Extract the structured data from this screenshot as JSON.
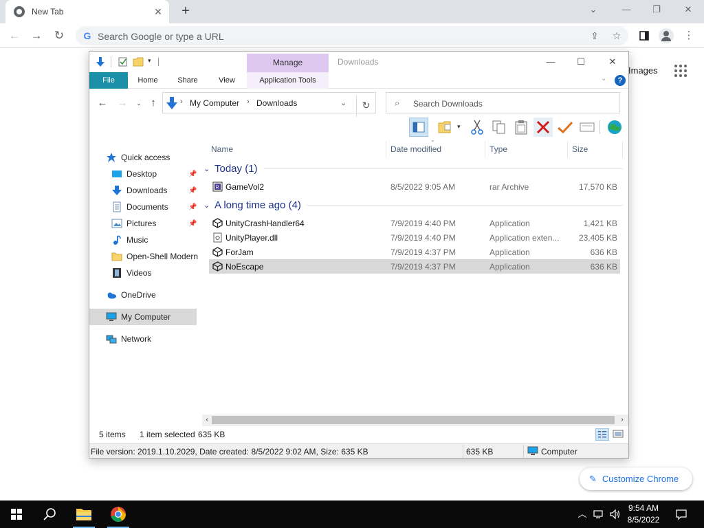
{
  "browser": {
    "tab_title": "New Tab",
    "tab_close": "✕",
    "new_tab": "+",
    "omnibox_placeholder": "Search Google or type a URL",
    "images_link": "Images",
    "customize_label": "Customize Chrome"
  },
  "explorer": {
    "title": "Downloads",
    "manage_label": "Manage",
    "ribbon_tabs": [
      "File",
      "Home",
      "Share",
      "View",
      "Application Tools"
    ],
    "breadcrumb": [
      "My Computer",
      "Downloads"
    ],
    "search_placeholder": "Search Downloads",
    "nav": {
      "quick_access": "Quick access",
      "desktop": "Desktop",
      "downloads": "Downloads",
      "documents": "Documents",
      "pictures": "Pictures",
      "music": "Music",
      "open_shell": "Open-Shell Modern",
      "videos": "Videos",
      "onedrive": "OneDrive",
      "my_computer": "My Computer",
      "network": "Network"
    },
    "columns": [
      "Name",
      "Date modified",
      "Type",
      "Size"
    ],
    "groups": [
      {
        "label": "Today (1)",
        "files": [
          {
            "name": "GameVol2",
            "date": "8/5/2022 9:05 AM",
            "type": "rar Archive",
            "size": "17,570 KB"
          }
        ]
      },
      {
        "label": "A long time ago (4)",
        "files": [
          {
            "name": "UnityCrashHandler64",
            "date": "7/9/2019 4:40 PM",
            "type": "Application",
            "size": "1,421 KB"
          },
          {
            "name": "UnityPlayer.dll",
            "date": "7/9/2019 4:40 PM",
            "type": "Application exten...",
            "size": "23,405 KB"
          },
          {
            "name": "ForJam",
            "date": "7/9/2019 4:37 PM",
            "type": "Application",
            "size": "636 KB"
          },
          {
            "name": "NoEscape",
            "date": "7/9/2019 4:37 PM",
            "type": "Application",
            "size": "636 KB"
          }
        ]
      }
    ],
    "status": {
      "item_count": "5 items",
      "selection": "1 item selected",
      "selection_size": "635 KB",
      "file_info": "File version: 2019.1.10.2029, Date created: 8/5/2022 9:02 AM, Size: 635 KB",
      "size2": "635 KB",
      "location": "Computer"
    }
  },
  "taskbar": {
    "time": "9:54 AM",
    "date": "8/5/2022"
  },
  "colors": {
    "file_tab": "#1b8fa8",
    "manage_band": "#dfc8f0",
    "group_header": "#1e3287",
    "selection": "#d9d9d9",
    "taskbar": "#0a0a0a",
    "accent": "#1a73e8"
  },
  "icons": {
    "back": "arrow-left-icon",
    "forward": "arrow-right-icon",
    "reload": "reload-icon",
    "share": "share-icon",
    "bookmark": "star-icon",
    "side_panel": "side-panel-icon",
    "profile": "profile-icon",
    "menu": "kebab-menu-icon",
    "apps": "apps-grid-icon",
    "delete": "delete-x-icon",
    "start": "windows-logo-icon"
  }
}
